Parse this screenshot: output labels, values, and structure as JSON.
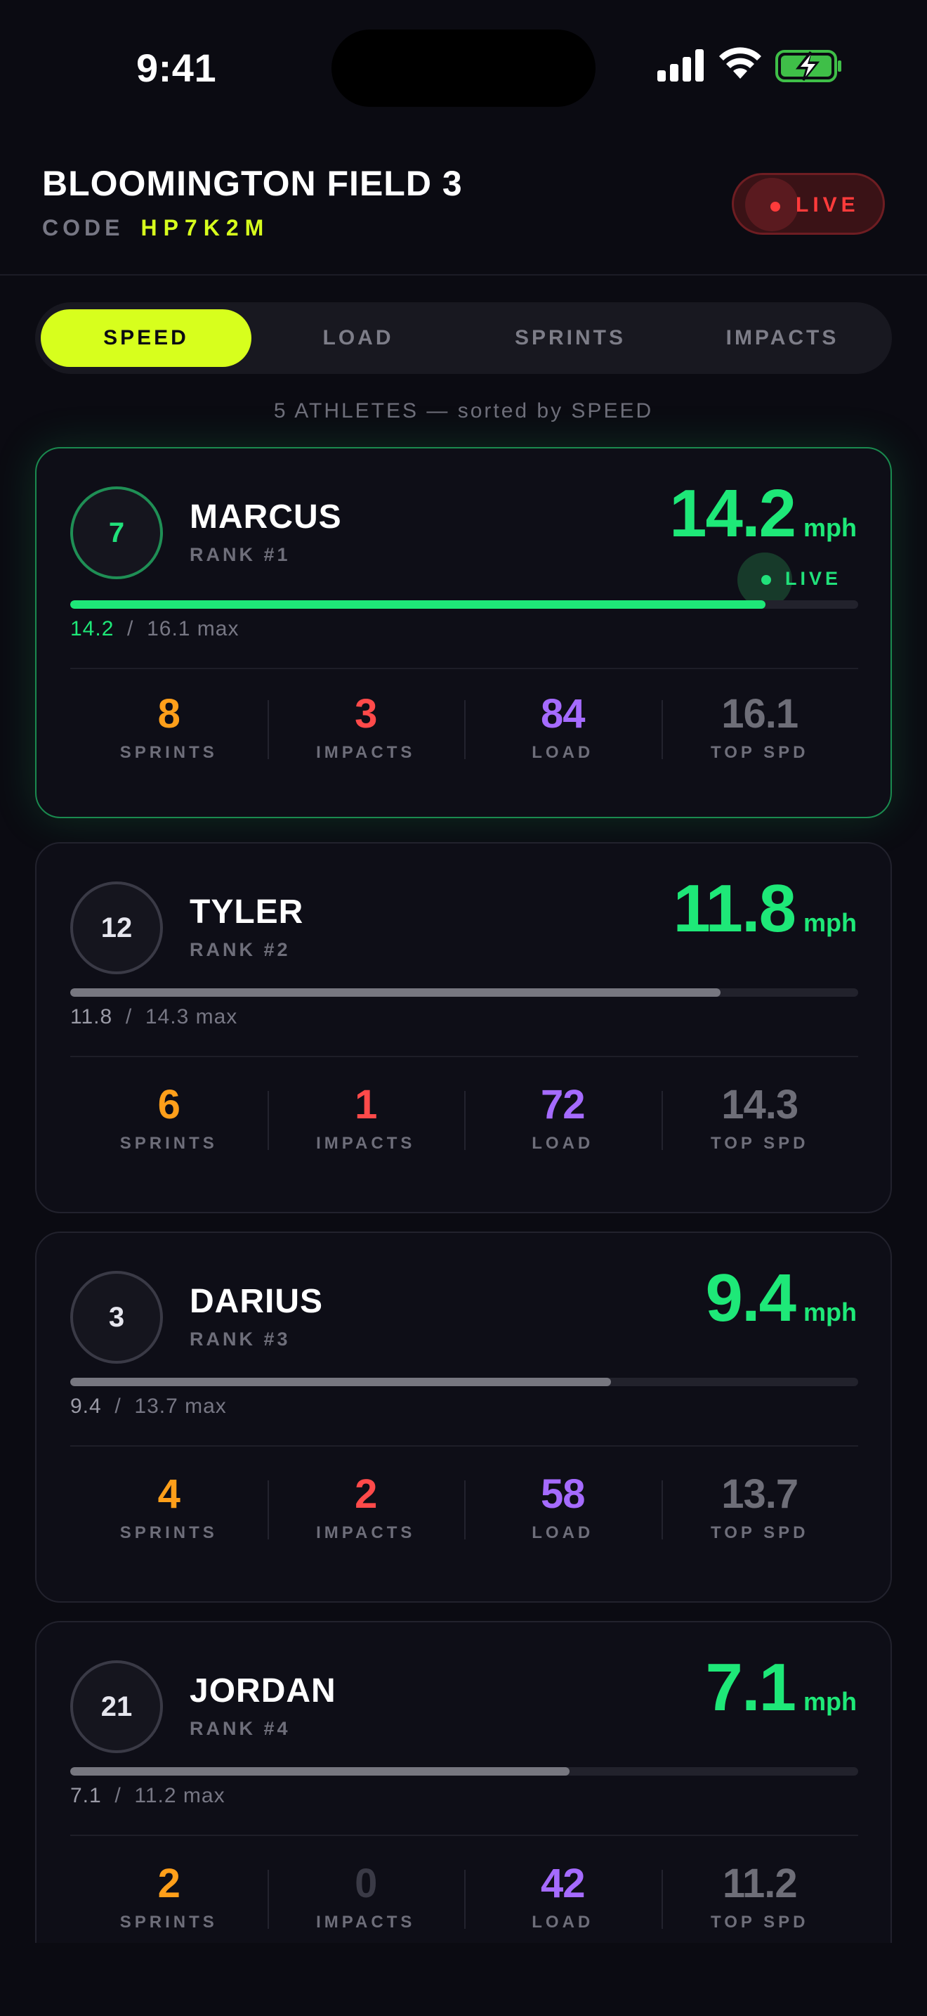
{
  "status_bar": {
    "time": "9:41"
  },
  "header": {
    "title": "BLOOMINGTON FIELD 3",
    "code_label": "CODE",
    "code_value": "HP7K2M",
    "live_label": "LIVE"
  },
  "tabs": [
    {
      "label": "SPEED",
      "active": true
    },
    {
      "label": "LOAD",
      "active": false
    },
    {
      "label": "SPRINTS",
      "active": false
    },
    {
      "label": "IMPACTS",
      "active": false
    }
  ],
  "summary": "5 ATHLETES — sorted by SPEED",
  "speed_unit": "mph",
  "stat_labels": {
    "sprints": "SPRINTS",
    "impacts": "IMPACTS",
    "load": "LOAD",
    "top_speed": "TOP SPD"
  },
  "athletes": [
    {
      "jersey": "7",
      "name": "MARCUS",
      "rank": "RANK #1",
      "speed": "14.2",
      "max": "16.1",
      "max_text": "16.1 max",
      "live": true,
      "live_label": "LIVE",
      "progress": 0.882,
      "sprints": "8",
      "impacts": "3",
      "load": "84",
      "top_speed": "16.1"
    },
    {
      "jersey": "12",
      "name": "TYLER",
      "rank": "RANK #2",
      "speed": "11.8",
      "max": "14.3",
      "max_text": "14.3 max",
      "live": false,
      "progress": 0.825,
      "sprints": "6",
      "impacts": "1",
      "load": "72",
      "top_speed": "14.3"
    },
    {
      "jersey": "3",
      "name": "DARIUS",
      "rank": "RANK #3",
      "speed": "9.4",
      "max": "13.7",
      "max_text": "13.7 max",
      "live": false,
      "progress": 0.686,
      "sprints": "4",
      "impacts": "2",
      "load": "58",
      "top_speed": "13.7"
    },
    {
      "jersey": "21",
      "name": "JORDAN",
      "rank": "RANK #4",
      "speed": "7.1",
      "max": "11.2",
      "max_text": "11.2 max",
      "live": false,
      "progress": 0.634,
      "sprints": "2",
      "impacts": "0",
      "load": "42",
      "top_speed": "11.2"
    }
  ],
  "colors": {
    "accent": "#d7ff1d",
    "speed_green": "#1ee878",
    "sprints": "#ff9f1a",
    "impacts": "#ff4a4a",
    "load": "#a56bff",
    "live_red": "#ff3b3b"
  }
}
